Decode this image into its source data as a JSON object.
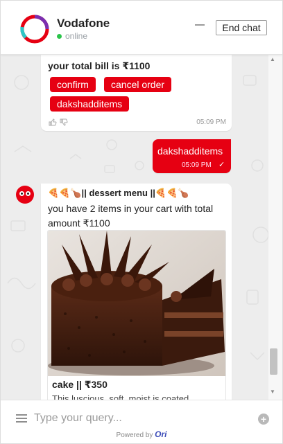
{
  "header": {
    "brand_name": "Vodafone",
    "status": "online",
    "end_chat_label": "End chat",
    "brand_color": "#e60012",
    "status_color": "#2bc44a"
  },
  "messages": {
    "bill": {
      "text": "your total bill is ₹1100",
      "chips": [
        "confirm",
        "cancel order",
        "dakshadditems"
      ],
      "time": "05:09 PM",
      "icons": [
        "thumbs-up-icon",
        "thumbs-down-icon"
      ]
    },
    "user_reply": {
      "text": "dakshadditems",
      "time": "05:09 PM",
      "status_icon": "checkmark-icon"
    },
    "dessert": {
      "title": "🍕🍕🍗|| dessert menu ||🍕🍕🍗",
      "body": "you have 2 items in your cart with total amount ₹1100",
      "card": {
        "image": "chocolate-cake",
        "title": "cake || ₹350",
        "description": "This luscious, soft, moist is coated"
      }
    }
  },
  "composer": {
    "placeholder": "Type your query...",
    "powered_by": "Powered by",
    "powered_brand": "Ori"
  }
}
